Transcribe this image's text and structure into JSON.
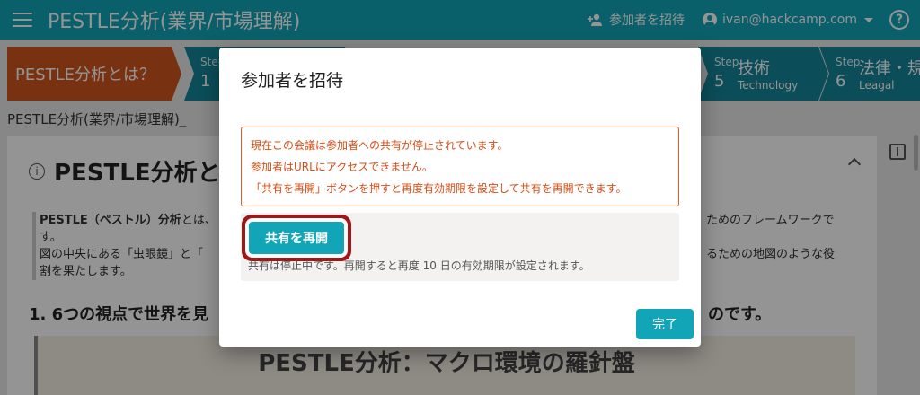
{
  "appbar": {
    "title": "PESTLE分析(業界/市場理解)",
    "invite_label": "参加者を招待",
    "user_email": "ivan@hackcamp.com",
    "help_glyph": "?",
    "icons": {
      "menu": "menu-icon",
      "invite": "person-add-icon",
      "user": "account-circle-icon",
      "help": "help-circle-icon"
    }
  },
  "steps": {
    "intro": "PESTLE分析とは？",
    "step_word": "Step",
    "items": [
      {
        "num": "1",
        "name": "",
        "sub": ""
      },
      {
        "num": "5",
        "name": "技術",
        "sub": "Technology"
      },
      {
        "num": "6",
        "name": "法律・規",
        "sub": "Leagal"
      }
    ]
  },
  "breadcrumb": "PESTLE分析(業界/市場理解)_",
  "card": {
    "title": "PESTLE分析と",
    "para1_bold": "PESTLE（ペストル）分析",
    "para1_text": "とは、",
    "para1_right": "ためのフレームワークで",
    "para1_cont": "す。",
    "para2_left": "図の中央にある「虫眼鏡」と「",
    "para2_right": "るための地図のような役",
    "para2_cont": "割を果たします。",
    "section_head": "1. 6つの視点で世界を見",
    "section_head_end": "のです。",
    "figure_title": "PESTLE分析：マクロ環境の羅針盤"
  },
  "dialog": {
    "title": "参加者を招待",
    "alert_lines": [
      "現在この会議は参加者への共有が停止されています。",
      "参加者はURLにアクセスできません。",
      "「共有を再開」ボタンを押すと再度有効期限を設定して共有を再開できます。"
    ],
    "resume_label": "共有を再開",
    "resume_note": "共有は停止中です。再開すると再度 10 日の有効期限が設定されます。",
    "done_label": "完了"
  },
  "colors": {
    "primary": "#12a5b7",
    "step": "#138799",
    "intro": "#d1561e",
    "alert": "#d84d16",
    "highlight": "#a11717"
  }
}
